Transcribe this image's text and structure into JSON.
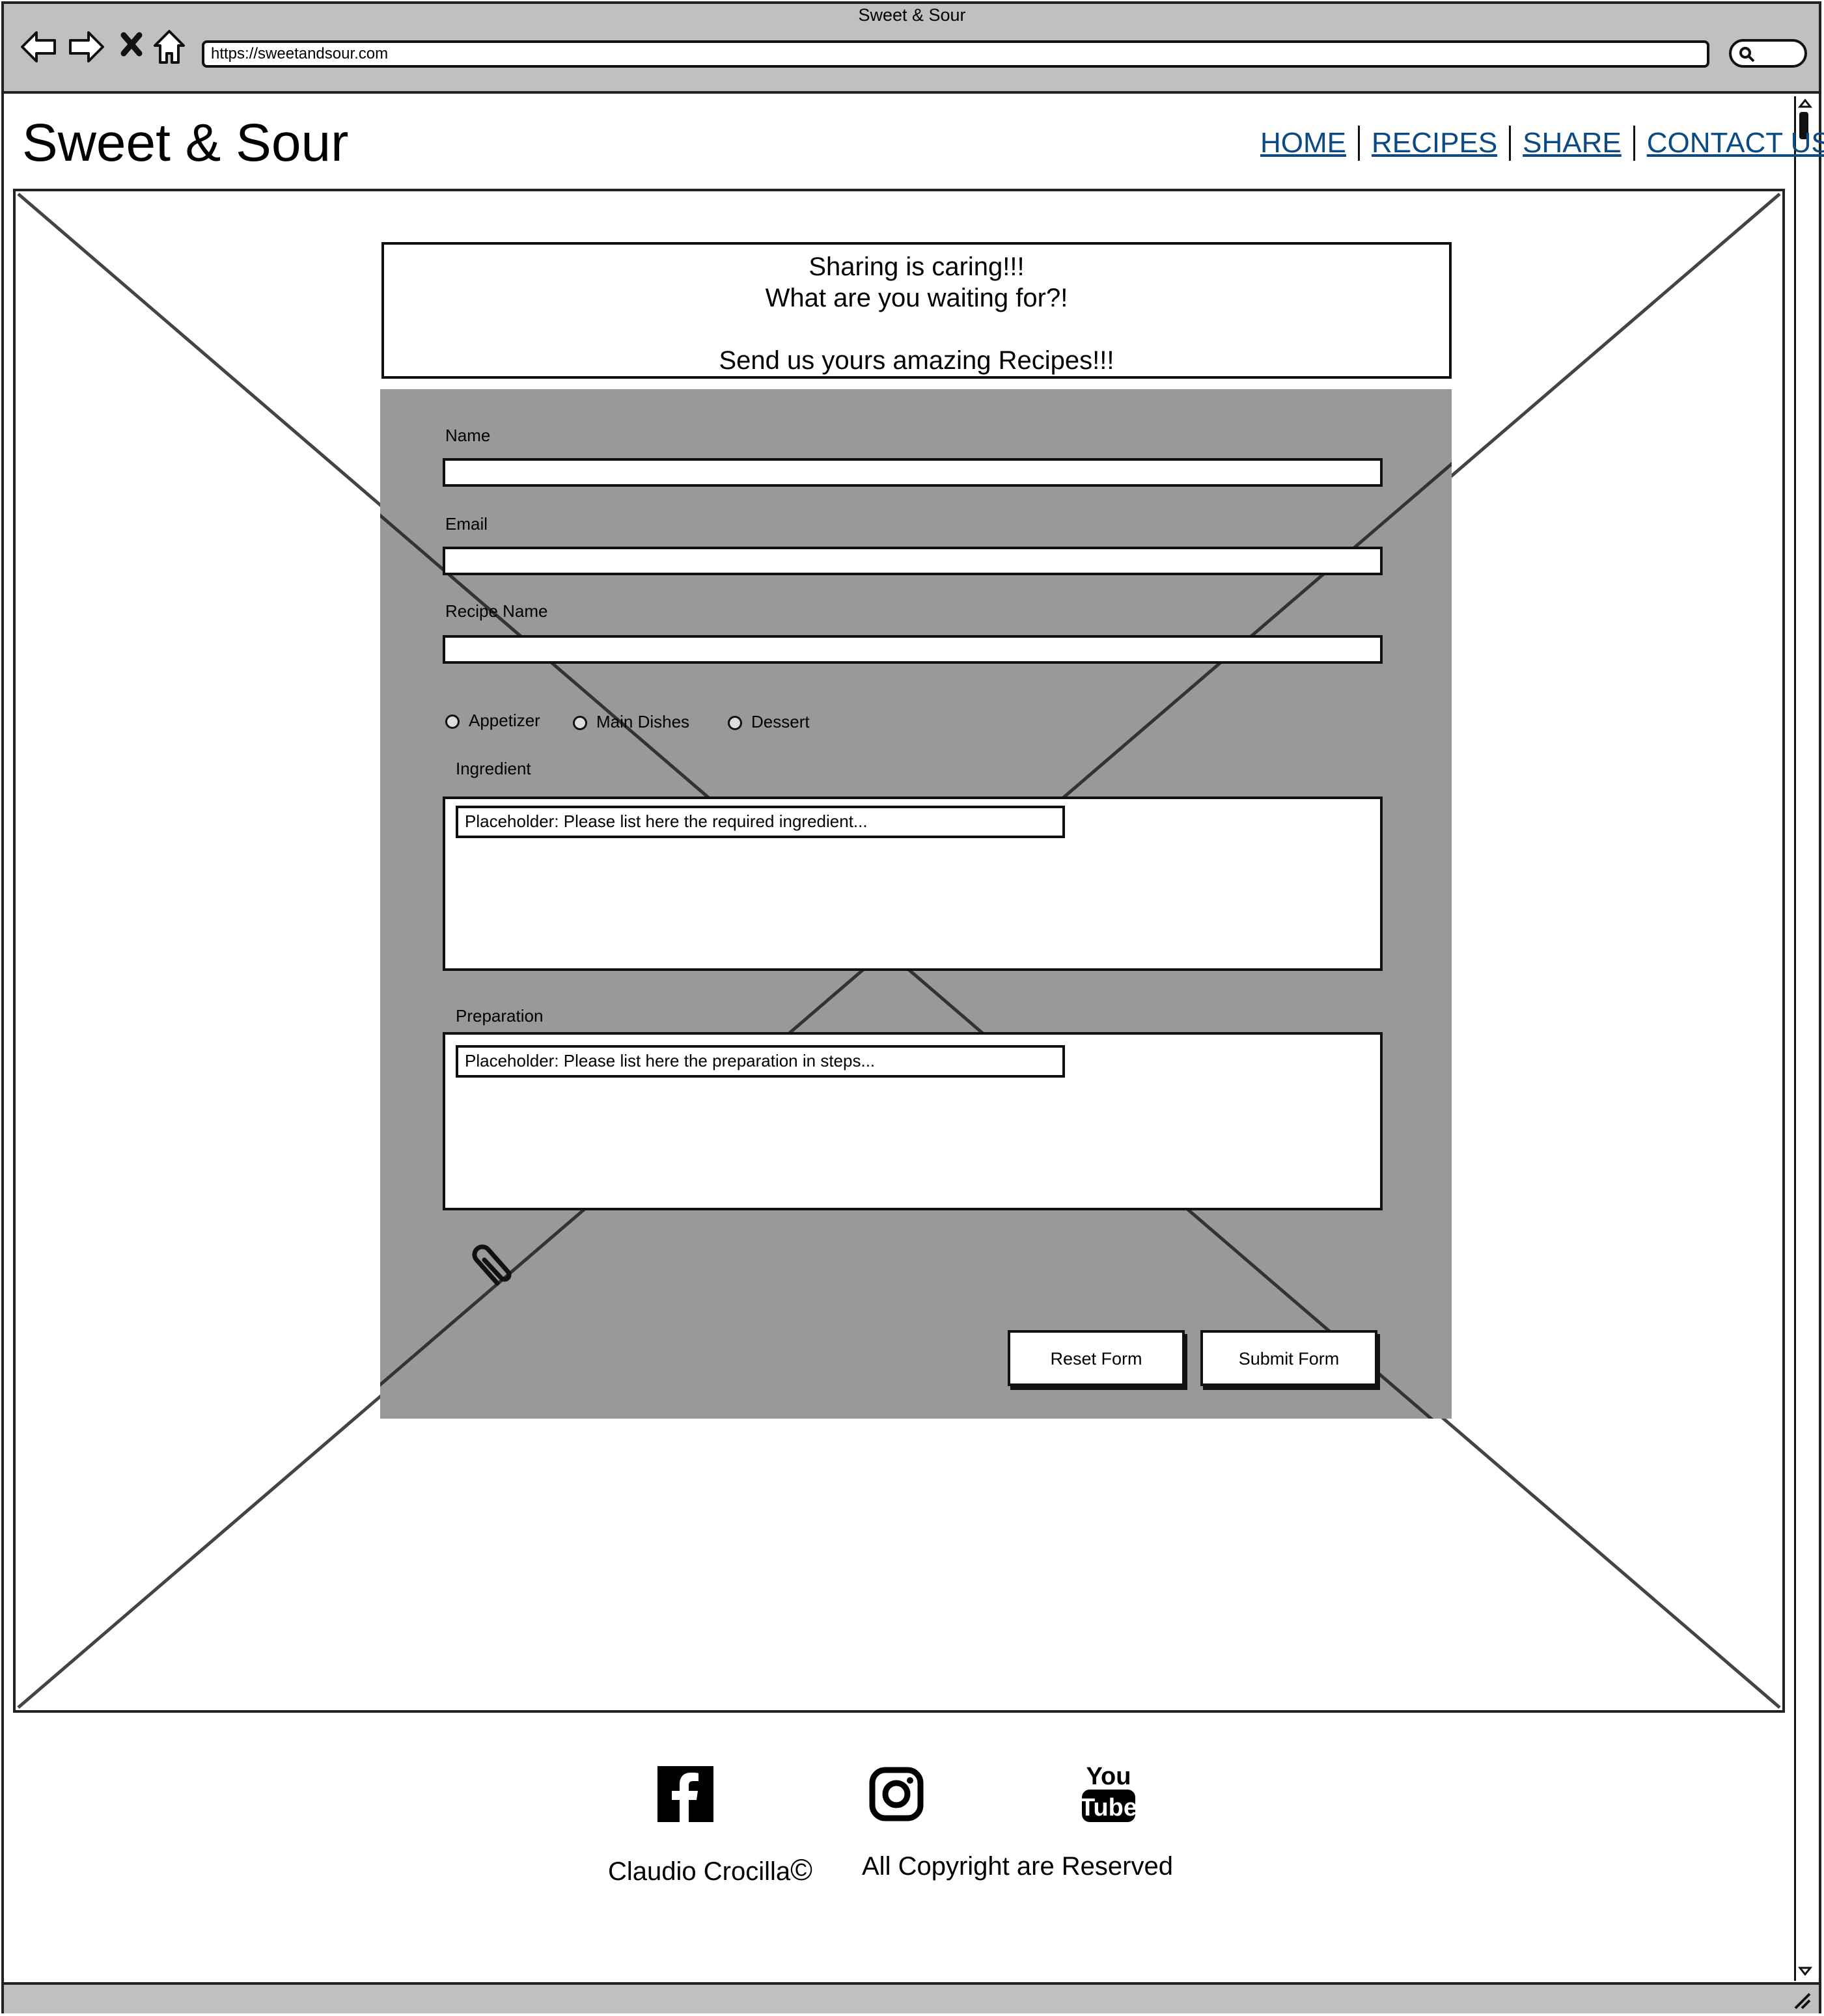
{
  "browser": {
    "title": "Sweet & Sour",
    "url": "https://sweetandsour.com",
    "icons": [
      "back-arrow-icon",
      "forward-arrow-icon",
      "close-icon",
      "home-icon",
      "search-icon"
    ]
  },
  "header": {
    "site_title": "Sweet & Sour",
    "nav": [
      "HOME",
      "RECIPES",
      "SHARE",
      "CONTACT US"
    ],
    "link_color": "#0b4a85"
  },
  "banner": {
    "line1": "Sharing is caring!!!",
    "line2": "What are you waiting for?!",
    "line3": "Send us yours amazing Recipes!!!"
  },
  "form": {
    "background": "#999999",
    "name_label": "Name",
    "email_label": "Email",
    "recipe_name_label": "Recipe Name",
    "categories": [
      "Appetizer",
      "Main Dishes",
      "Dessert"
    ],
    "ingredient_label": "Ingredient",
    "ingredient_placeholder": "Placeholder: Please list here the required ingredient...",
    "preparation_label": "Preparation",
    "preparation_placeholder": "Placeholder: Please list here the preparation in steps...",
    "attach_icon": "paperclip-icon",
    "reset_label": "Reset Form",
    "submit_label": "Submit Form"
  },
  "footer": {
    "social_icons": [
      "facebook-icon",
      "instagram-icon",
      "youtube-icon"
    ],
    "author": "Claudio Crocilla",
    "copyright_symbol": "©",
    "rights": "All Copyright are Reserved"
  }
}
